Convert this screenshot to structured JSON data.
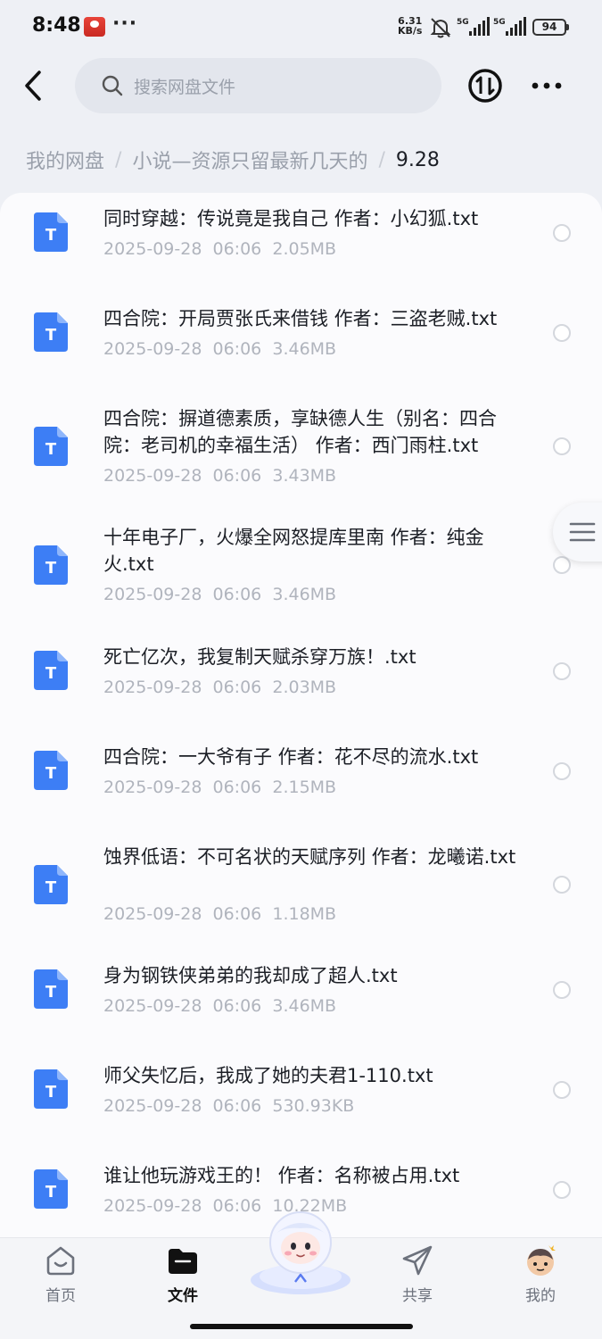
{
  "status_bar": {
    "time": "8:48",
    "more": "···",
    "net_speed_value": "6.31",
    "net_speed_unit": "KB/s",
    "signal1_label": "5G",
    "signal2_label": "5G",
    "battery": "94"
  },
  "header": {
    "search_placeholder": "搜索网盘文件"
  },
  "breadcrumb": {
    "items": [
      "我的网盘",
      "小说—资源只留最新几天的",
      "9.28"
    ],
    "separator": "/"
  },
  "files": [
    {
      "name": "同时穿越：传说竟是我自己 作者：小幻狐.txt",
      "date": "2025-09-28  06:06",
      "size": "2.05MB"
    },
    {
      "name": "四合院：开局贾张氏来借钱 作者：三盗老贼.txt",
      "date": "2025-09-28  06:06",
      "size": "3.46MB"
    },
    {
      "name": "四合院：摒道德素质，享缺德人生（别名：四合院：老司机的幸福生活） 作者：西门雨柱.txt",
      "date": "2025-09-28  06:06",
      "size": "3.43MB"
    },
    {
      "name": "十年电子厂，火爆全网怒提库里南 作者：纯金火.txt",
      "date": "2025-09-28  06:06",
      "size": "3.46MB"
    },
    {
      "name": "死亡亿次，我复制天赋杀穿万族！.txt",
      "date": "2025-09-28  06:06",
      "size": "2.03MB"
    },
    {
      "name": "四合院：一大爷有子 作者：花不尽的流水.txt",
      "date": "2025-09-28  06:06",
      "size": "2.15MB"
    },
    {
      "name": "蚀界低语：不可名状的天赋序列 作者：龙曦诺.txt",
      "date": "2025-09-28  06:06",
      "size": "1.18MB"
    },
    {
      "name": "身为钢铁侠弟弟的我却成了超人.txt",
      "date": "2025-09-28  06:06",
      "size": "3.46MB"
    },
    {
      "name": "师父失忆后，我成了她的夫君1-110.txt",
      "date": "2025-09-28  06:06",
      "size": "530.93KB"
    },
    {
      "name": "谁让他玩游戏王的！ 作者：名称被占用.txt",
      "date": "2025-09-28  06:06",
      "size": "10.22MB"
    }
  ],
  "file_icon_letter": "T",
  "bottom_nav": {
    "home": "首页",
    "files": "文件",
    "share": "共享",
    "mine": "我的"
  },
  "colors": {
    "file_icon": "#3d7ef5",
    "accent_text": "#111111",
    "muted_text": "#b0b4bd"
  }
}
